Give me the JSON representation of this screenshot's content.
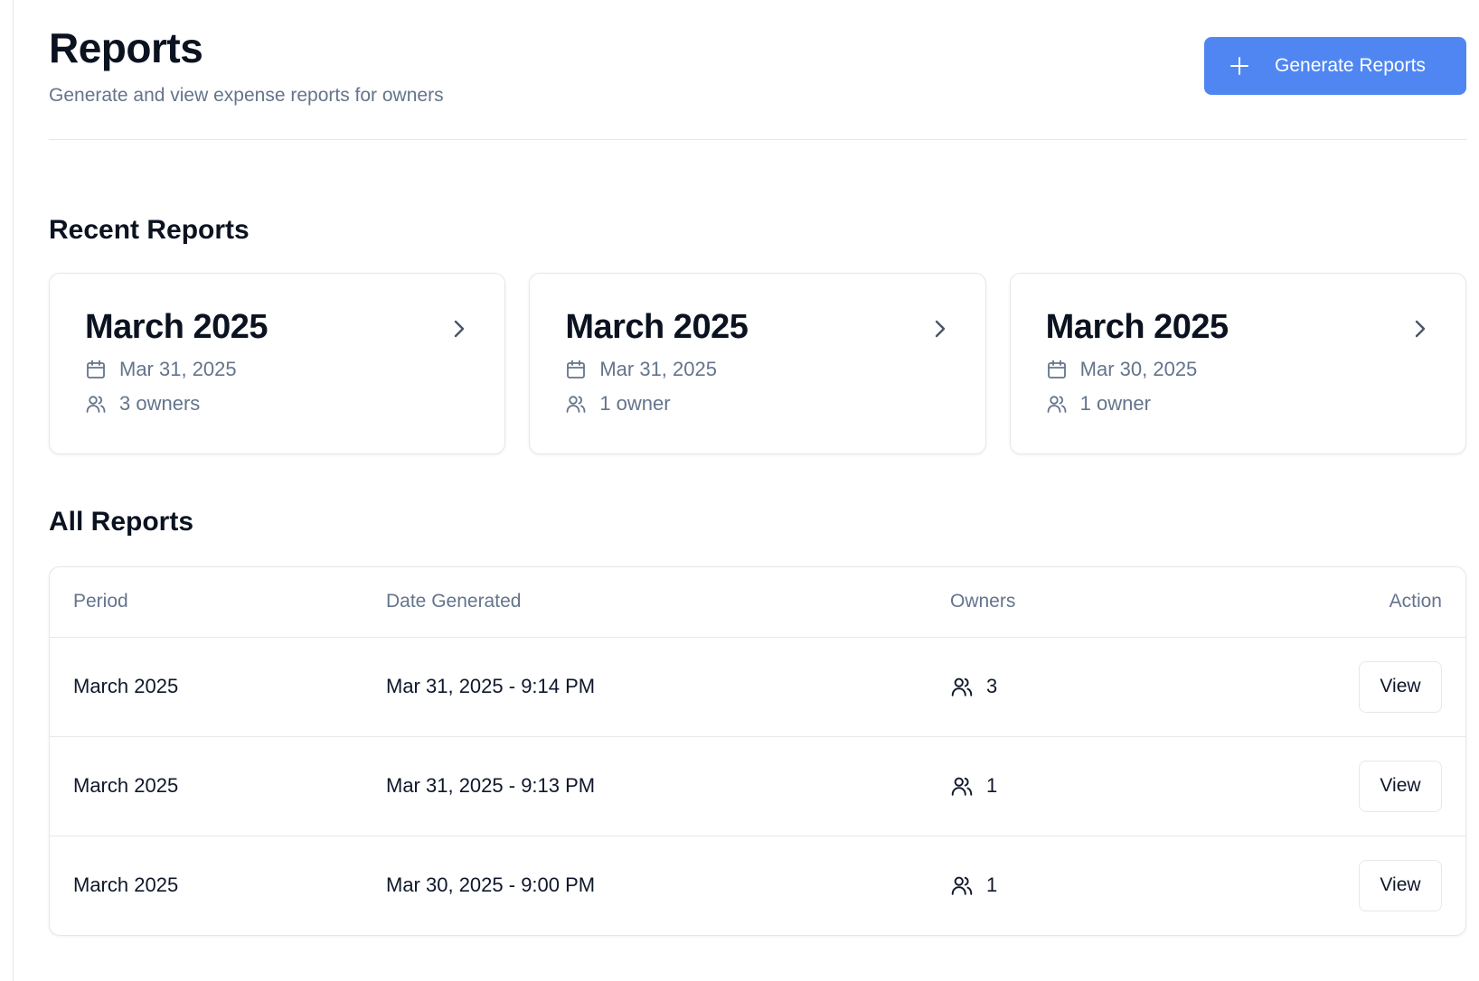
{
  "header": {
    "title": "Reports",
    "subtitle": "Generate and view expense reports for owners",
    "generate_button": {
      "label": "Generate Reports",
      "icon": "plus-icon"
    }
  },
  "recent": {
    "title": "Recent Reports",
    "cards": [
      {
        "title": "March 2025",
        "date": "Mar 31, 2025",
        "owners": "3 owners"
      },
      {
        "title": "March 2025",
        "date": "Mar 31, 2025",
        "owners": "1 owner"
      },
      {
        "title": "March 2025",
        "date": "Mar 30, 2025",
        "owners": "1 owner"
      }
    ]
  },
  "all": {
    "title": "All Reports",
    "columns": [
      "Period",
      "Date Generated",
      "Owners",
      "Action"
    ],
    "rows": [
      {
        "period": "March 2025",
        "date_generated": "Mar 31, 2025 - 9:14 PM",
        "owners": "3",
        "action": "View"
      },
      {
        "period": "March 2025",
        "date_generated": "Mar 31, 2025 - 9:13 PM",
        "owners": "1",
        "action": "View"
      },
      {
        "period": "March 2025",
        "date_generated": "Mar 30, 2025 - 9:00 PM",
        "owners": "1",
        "action": "View"
      }
    ]
  },
  "colors": {
    "primary": "#4f86f2",
    "text": "#0f172a",
    "muted": "#64748b",
    "border": "#e5e7eb"
  }
}
